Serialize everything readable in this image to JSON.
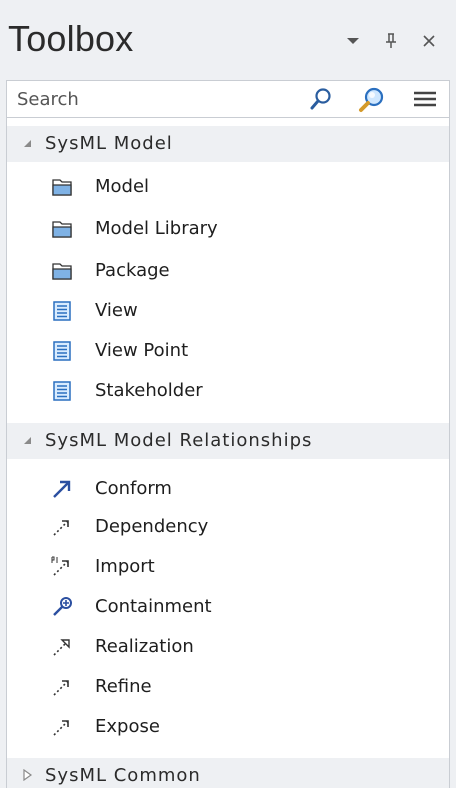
{
  "panel": {
    "title": "Toolbox"
  },
  "search": {
    "placeholder": "Search",
    "value": ""
  },
  "groups": [
    {
      "label": "SysML Model",
      "expanded": true,
      "items": [
        {
          "label": "Model",
          "icon": "model-folder-icon"
        },
        {
          "label": "Model Library",
          "icon": "model-library-folder-icon"
        },
        {
          "label": "Package",
          "icon": "package-folder-icon"
        },
        {
          "label": "View",
          "icon": "view-icon"
        },
        {
          "label": "View Point",
          "icon": "viewpoint-icon"
        },
        {
          "label": "Stakeholder",
          "icon": "stakeholder-icon"
        }
      ]
    },
    {
      "label": "SysML Model Relationships",
      "expanded": true,
      "items": [
        {
          "label": "Conform",
          "icon": "conform-arrow-icon"
        },
        {
          "label": "Dependency",
          "icon": "dependency-arrow-icon"
        },
        {
          "label": "Import",
          "icon": "import-arrow-icon"
        },
        {
          "label": "Containment",
          "icon": "containment-icon"
        },
        {
          "label": "Realization",
          "icon": "realization-arrow-icon"
        },
        {
          "label": "Refine",
          "icon": "refine-arrow-icon"
        },
        {
          "label": "Expose",
          "icon": "expose-arrow-icon"
        }
      ]
    },
    {
      "label": "SysML Common",
      "expanded": false,
      "items": []
    }
  ]
}
